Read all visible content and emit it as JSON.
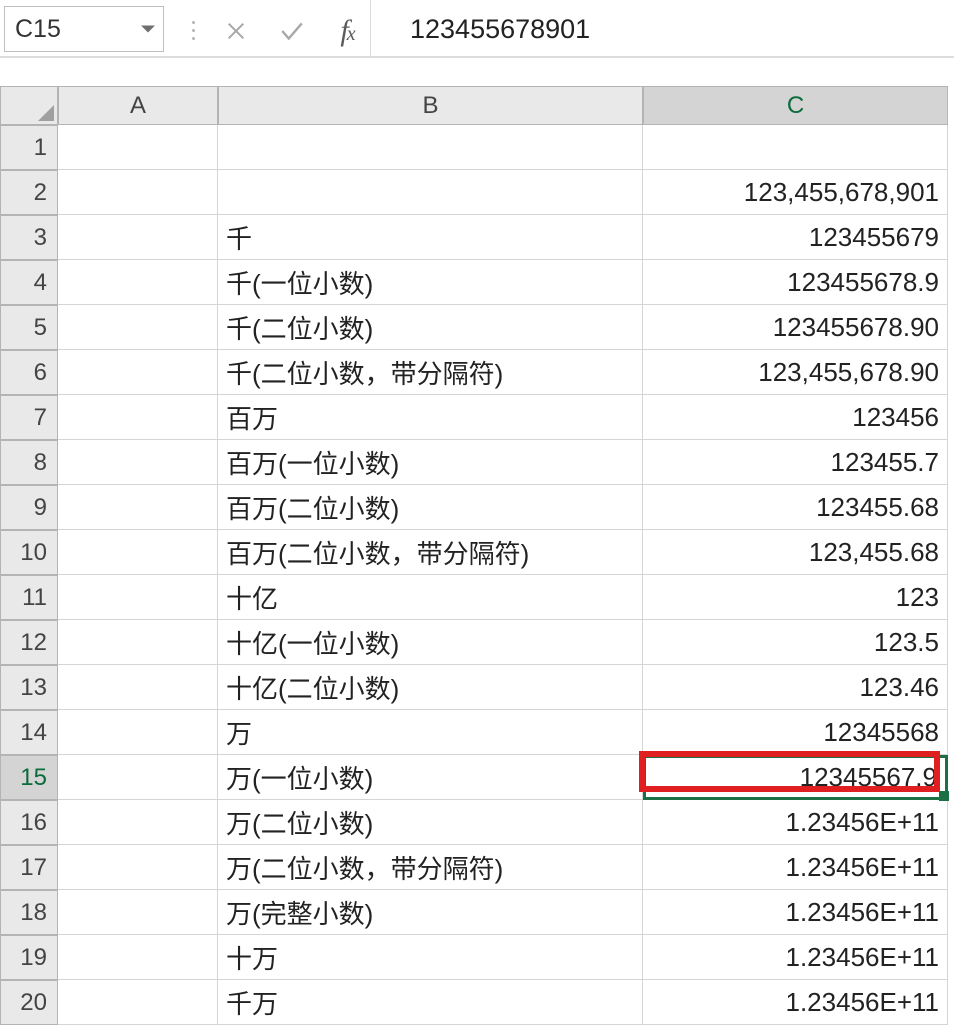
{
  "formula_bar": {
    "cell_reference": "C15",
    "formula_value": "123455678901"
  },
  "columns": [
    "A",
    "B",
    "C"
  ],
  "active_row": 15,
  "active_col": "C",
  "rows": [
    {
      "n": 1,
      "b": "",
      "c": ""
    },
    {
      "n": 2,
      "b": "",
      "c": "123,455,678,901"
    },
    {
      "n": 3,
      "b": "千",
      "c": "123455679"
    },
    {
      "n": 4,
      "b": "千(一位小数)",
      "c": "123455678.9"
    },
    {
      "n": 5,
      "b": "千(二位小数)",
      "c": "123455678.90"
    },
    {
      "n": 6,
      "b": "千(二位小数，带分隔符)",
      "c": "123,455,678.90"
    },
    {
      "n": 7,
      "b": "百万",
      "c": "123456"
    },
    {
      "n": 8,
      "b": "百万(一位小数)",
      "c": "123455.7"
    },
    {
      "n": 9,
      "b": "百万(二位小数)",
      "c": "123455.68"
    },
    {
      "n": 10,
      "b": "百万(二位小数，带分隔符)",
      "c": "123,455.68"
    },
    {
      "n": 11,
      "b": "十亿",
      "c": "123"
    },
    {
      "n": 12,
      "b": "十亿(一位小数)",
      "c": "123.5"
    },
    {
      "n": 13,
      "b": "十亿(二位小数)",
      "c": "123.46"
    },
    {
      "n": 14,
      "b": "万",
      "c": "12345568"
    },
    {
      "n": 15,
      "b": "万(一位小数)",
      "c": "12345567.9"
    },
    {
      "n": 16,
      "b": "万(二位小数)",
      "c": "1.23456E+11"
    },
    {
      "n": 17,
      "b": "万(二位小数，带分隔符)",
      "c": "1.23456E+11"
    },
    {
      "n": 18,
      "b": "万(完整小数)",
      "c": "1.23456E+11"
    },
    {
      "n": 19,
      "b": "十万",
      "c": "1.23456E+11"
    },
    {
      "n": 20,
      "b": "千万",
      "c": "1.23456E+11"
    }
  ]
}
